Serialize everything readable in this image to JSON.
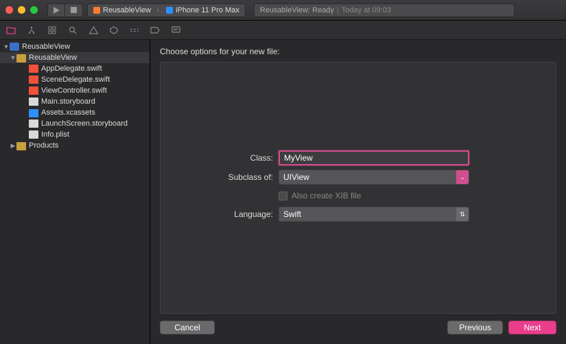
{
  "toolbar": {
    "scheme_target": "ReusableView",
    "scheme_device": "iPhone 11 Pro Max",
    "status_project": "ReusableView:",
    "status_state": "Ready",
    "status_time": "Today at 09:03"
  },
  "sidebar": {
    "project": "ReusableView",
    "group": "ReusableView",
    "files": [
      "AppDelegate.swift",
      "SceneDelegate.swift",
      "ViewController.swift",
      "Main.storyboard",
      "Assets.xcassets",
      "LaunchScreen.storyboard",
      "Info.plist"
    ],
    "products": "Products"
  },
  "sheet": {
    "title": "Choose options for your new file:",
    "labels": {
      "class": "Class:",
      "subclass": "Subclass of:",
      "language": "Language:",
      "xib": "Also create XIB file"
    },
    "values": {
      "class": "MyView",
      "subclass": "UIView",
      "language": "Swift"
    },
    "buttons": {
      "cancel": "Cancel",
      "previous": "Previous",
      "next": "Next"
    }
  }
}
